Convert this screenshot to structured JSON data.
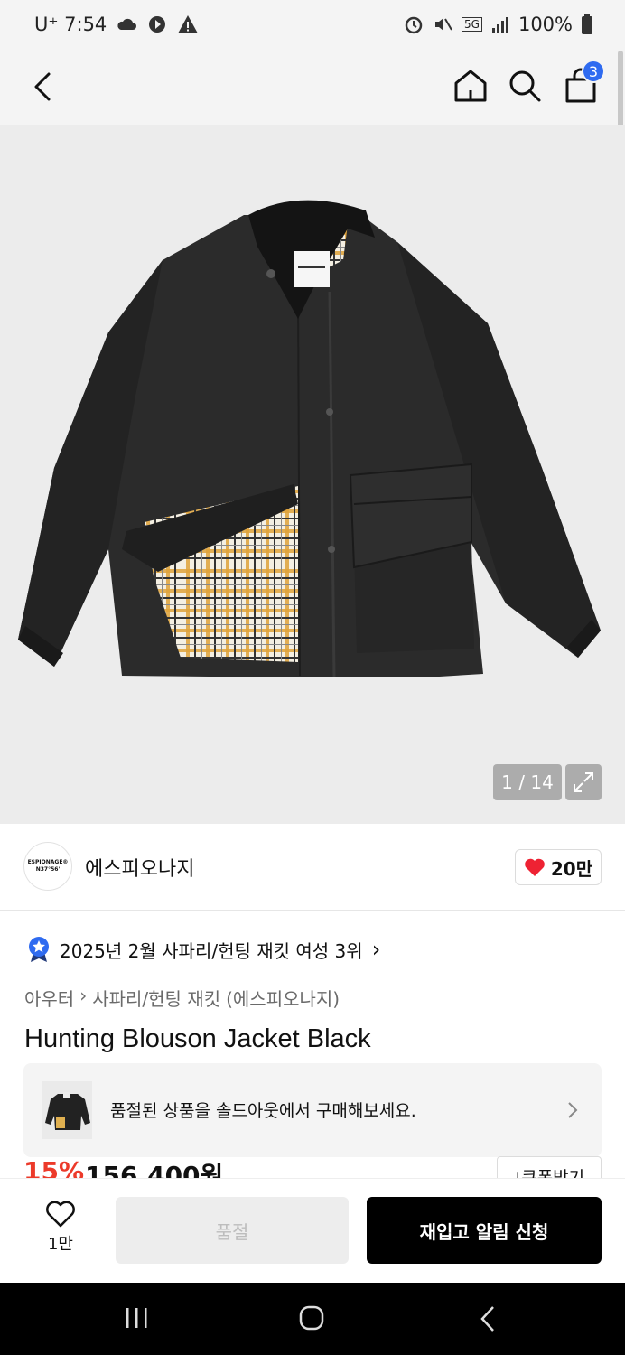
{
  "status_bar": {
    "carrier_time": "U⁺ 7:54",
    "battery": "100%",
    "network": "5G"
  },
  "header": {
    "cart_count": "3"
  },
  "gallery": {
    "counter": "1 / 14"
  },
  "brand": {
    "logo_line1": "ESPIONAGE®",
    "logo_line2": "N37°56'",
    "name": "에스피오나지",
    "likes": "20만"
  },
  "ranking": {
    "text": "2025년 2월 사파리/헌팅 재킷 여성 3위",
    "chevron": "›"
  },
  "breadcrumb": {
    "items": [
      "아우터",
      "›",
      "사파리/헌팅 재킷",
      "(에스피오나지)"
    ]
  },
  "product": {
    "title": "Hunting Blouson Jacket Black"
  },
  "soldout_banner": {
    "text": "품절된 상품을 솔드아웃에서 구매해보세요."
  },
  "price": {
    "discount": "15%",
    "amount": "156,400원",
    "coupon_label": "⤓쿠폰받기"
  },
  "bottom_bar": {
    "wish_count": "1만",
    "soldout_label": "품절",
    "restock_label": "재입고 알림 신청"
  },
  "colors": {
    "accent_blue": "#2f6bf0",
    "discount_red": "#ec3a2a",
    "heart_red": "#ee2233"
  }
}
